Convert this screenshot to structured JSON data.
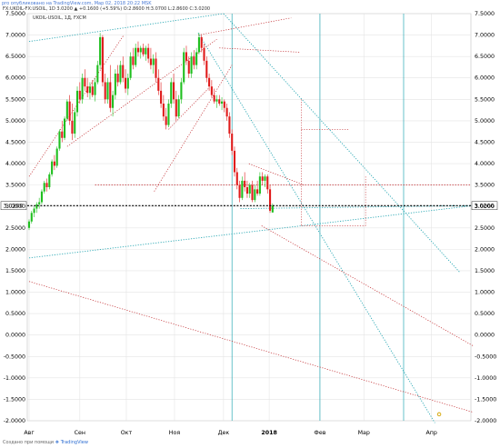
{
  "header": {
    "published_line": "pro опубликовано на TradingView.com, Мар 02, 2018 20:22 MSK",
    "symbol_line": "FX:UKOIL-FX:USOIL, 1D  3.0200  ▲ +0.1600 (+5.59%)  O:2.8600  H:3.0700  L:2.8600  C:3.0200",
    "legend": "UKOIL-USOIL, 1Д, FXCM"
  },
  "footer": {
    "prefix": "Создано при помощи",
    "brand": "TradingView"
  },
  "colors": {
    "up": "#1fbf1f",
    "down": "#e01b1b",
    "grid": "#e4e4e4",
    "cyan": "#2aa8b4",
    "red_dotted": "#c0282c",
    "price_line": "#000000",
    "axis_text": "#000000"
  },
  "chart_data": {
    "type": "candlestick",
    "symbol": "UKOIL-USOIL, 1Д, FXCM",
    "last_price_label": "3.0200",
    "ylim": [
      -2.0,
      7.5
    ],
    "y_ticks": [
      "7.5000",
      "7.0000",
      "6.5000",
      "6.0000",
      "5.5000",
      "5.0000",
      "4.5000",
      "4.0000",
      "3.5000",
      "3.0000",
      "2.5000",
      "2.0000",
      "1.5000",
      "1.0000",
      "0.5000",
      "0.0000",
      "-0.5000",
      "-1.0000",
      "-1.5000",
      "-2.0000"
    ],
    "x_ticks": [
      "Авг",
      "Сен",
      "Окт",
      "Ноя",
      "Дек",
      "2018",
      "Фев",
      "Мар",
      "Апр"
    ],
    "x_tick_days": [
      0,
      60,
      115,
      172,
      230,
      284,
      344,
      396,
      476
    ],
    "candles": [
      {
        "d": 0,
        "o": 2.5,
        "h": 2.7,
        "l": 2.45,
        "c": 2.65
      },
      {
        "d": 3,
        "o": 2.65,
        "h": 2.9,
        "l": 2.6,
        "c": 2.85
      },
      {
        "d": 6,
        "o": 2.85,
        "h": 3.0,
        "l": 2.75,
        "c": 2.95
      },
      {
        "d": 9,
        "o": 2.95,
        "h": 3.1,
        "l": 2.85,
        "c": 3.05
      },
      {
        "d": 12,
        "o": 3.05,
        "h": 3.2,
        "l": 2.95,
        "c": 3.1
      },
      {
        "d": 15,
        "o": 3.1,
        "h": 3.4,
        "l": 3.05,
        "c": 3.35
      },
      {
        "d": 18,
        "o": 3.35,
        "h": 3.6,
        "l": 3.3,
        "c": 3.55
      },
      {
        "d": 21,
        "o": 3.55,
        "h": 3.65,
        "l": 3.35,
        "c": 3.45
      },
      {
        "d": 24,
        "o": 3.45,
        "h": 3.8,
        "l": 3.4,
        "c": 3.75
      },
      {
        "d": 27,
        "o": 3.75,
        "h": 4.1,
        "l": 3.7,
        "c": 4.05
      },
      {
        "d": 30,
        "o": 4.05,
        "h": 4.2,
        "l": 3.85,
        "c": 3.95
      },
      {
        "d": 33,
        "o": 3.95,
        "h": 4.4,
        "l": 3.9,
        "c": 4.35
      },
      {
        "d": 36,
        "o": 4.35,
        "h": 4.8,
        "l": 4.3,
        "c": 4.75
      },
      {
        "d": 39,
        "o": 4.75,
        "h": 5.0,
        "l": 4.5,
        "c": 4.6
      },
      {
        "d": 42,
        "o": 4.6,
        "h": 5.1,
        "l": 4.55,
        "c": 5.05
      },
      {
        "d": 45,
        "o": 5.05,
        "h": 5.5,
        "l": 5.0,
        "c": 5.45
      },
      {
        "d": 48,
        "o": 5.45,
        "h": 5.6,
        "l": 4.9,
        "c": 5.0
      },
      {
        "d": 51,
        "o": 5.0,
        "h": 5.4,
        "l": 4.55,
        "c": 4.7
      },
      {
        "d": 54,
        "o": 4.7,
        "h": 5.3,
        "l": 4.6,
        "c": 5.2
      },
      {
        "d": 57,
        "o": 5.2,
        "h": 5.8,
        "l": 5.1,
        "c": 5.7
      },
      {
        "d": 60,
        "o": 5.7,
        "h": 5.9,
        "l": 5.4,
        "c": 5.5
      },
      {
        "d": 63,
        "o": 5.5,
        "h": 6.1,
        "l": 5.4,
        "c": 6.0
      },
      {
        "d": 66,
        "o": 6.0,
        "h": 6.2,
        "l": 5.7,
        "c": 5.8
      },
      {
        "d": 69,
        "o": 5.8,
        "h": 6.0,
        "l": 5.55,
        "c": 5.65
      },
      {
        "d": 72,
        "o": 5.65,
        "h": 5.9,
        "l": 5.5,
        "c": 5.8
      },
      {
        "d": 75,
        "o": 5.8,
        "h": 5.95,
        "l": 5.55,
        "c": 5.6
      },
      {
        "d": 78,
        "o": 5.6,
        "h": 6.0,
        "l": 5.45,
        "c": 5.9
      },
      {
        "d": 81,
        "o": 5.9,
        "h": 6.4,
        "l": 5.85,
        "c": 6.3
      },
      {
        "d": 84,
        "o": 6.3,
        "h": 7.05,
        "l": 6.2,
        "c": 6.95
      },
      {
        "d": 87,
        "o": 6.95,
        "h": 7.0,
        "l": 5.8,
        "c": 5.9
      },
      {
        "d": 90,
        "o": 5.9,
        "h": 6.1,
        "l": 5.4,
        "c": 5.5
      },
      {
        "d": 93,
        "o": 5.5,
        "h": 6.0,
        "l": 5.4,
        "c": 5.9
      },
      {
        "d": 96,
        "o": 5.9,
        "h": 6.3,
        "l": 5.2,
        "c": 5.3
      },
      {
        "d": 99,
        "o": 5.3,
        "h": 5.7,
        "l": 5.1,
        "c": 5.6
      },
      {
        "d": 102,
        "o": 5.6,
        "h": 6.2,
        "l": 5.5,
        "c": 6.1
      },
      {
        "d": 105,
        "o": 6.1,
        "h": 6.3,
        "l": 5.8,
        "c": 5.9
      },
      {
        "d": 108,
        "o": 5.9,
        "h": 6.4,
        "l": 5.85,
        "c": 6.3
      },
      {
        "d": 111,
        "o": 6.3,
        "h": 6.5,
        "l": 5.9,
        "c": 6.0
      },
      {
        "d": 114,
        "o": 6.0,
        "h": 6.2,
        "l": 5.65,
        "c": 5.75
      },
      {
        "d": 117,
        "o": 5.75,
        "h": 6.1,
        "l": 5.6,
        "c": 6.0
      },
      {
        "d": 120,
        "o": 6.0,
        "h": 6.6,
        "l": 5.95,
        "c": 6.5
      },
      {
        "d": 123,
        "o": 6.5,
        "h": 6.7,
        "l": 6.2,
        "c": 6.3
      },
      {
        "d": 126,
        "o": 6.3,
        "h": 6.8,
        "l": 6.25,
        "c": 6.7
      },
      {
        "d": 129,
        "o": 6.7,
        "h": 6.85,
        "l": 6.5,
        "c": 6.6
      },
      {
        "d": 132,
        "o": 6.6,
        "h": 6.75,
        "l": 6.45,
        "c": 6.7
      },
      {
        "d": 135,
        "o": 6.7,
        "h": 6.8,
        "l": 6.5,
        "c": 6.55
      },
      {
        "d": 138,
        "o": 6.55,
        "h": 6.75,
        "l": 6.4,
        "c": 6.7
      },
      {
        "d": 141,
        "o": 6.7,
        "h": 6.8,
        "l": 6.35,
        "c": 6.45
      },
      {
        "d": 144,
        "o": 6.45,
        "h": 6.7,
        "l": 6.2,
        "c": 6.3
      },
      {
        "d": 147,
        "o": 6.3,
        "h": 6.55,
        "l": 6.1,
        "c": 6.45
      },
      {
        "d": 150,
        "o": 6.45,
        "h": 6.6,
        "l": 5.9,
        "c": 6.0
      },
      {
        "d": 153,
        "o": 6.0,
        "h": 6.2,
        "l": 5.6,
        "c": 5.7
      },
      {
        "d": 156,
        "o": 5.7,
        "h": 5.9,
        "l": 5.3,
        "c": 5.4
      },
      {
        "d": 159,
        "o": 5.4,
        "h": 5.6,
        "l": 5.0,
        "c": 5.1
      },
      {
        "d": 162,
        "o": 5.1,
        "h": 5.3,
        "l": 4.8,
        "c": 4.9
      },
      {
        "d": 165,
        "o": 4.9,
        "h": 5.5,
        "l": 4.85,
        "c": 5.4
      },
      {
        "d": 168,
        "o": 5.4,
        "h": 6.0,
        "l": 5.3,
        "c": 5.9
      },
      {
        "d": 171,
        "o": 5.9,
        "h": 6.1,
        "l": 5.4,
        "c": 5.5
      },
      {
        "d": 174,
        "o": 5.5,
        "h": 5.7,
        "l": 5.0,
        "c": 5.1
      },
      {
        "d": 177,
        "o": 5.1,
        "h": 5.6,
        "l": 5.05,
        "c": 5.5
      },
      {
        "d": 180,
        "o": 5.5,
        "h": 6.0,
        "l": 5.4,
        "c": 5.9
      },
      {
        "d": 183,
        "o": 5.9,
        "h": 6.7,
        "l": 5.85,
        "c": 6.6
      },
      {
        "d": 186,
        "o": 6.6,
        "h": 6.75,
        "l": 6.3,
        "c": 6.4
      },
      {
        "d": 189,
        "o": 6.4,
        "h": 6.5,
        "l": 6.0,
        "c": 6.1
      },
      {
        "d": 192,
        "o": 6.1,
        "h": 6.6,
        "l": 6.0,
        "c": 6.5
      },
      {
        "d": 195,
        "o": 6.5,
        "h": 6.65,
        "l": 6.2,
        "c": 6.3
      },
      {
        "d": 198,
        "o": 6.3,
        "h": 6.7,
        "l": 6.2,
        "c": 6.6
      },
      {
        "d": 201,
        "o": 6.6,
        "h": 7.05,
        "l": 6.55,
        "c": 6.95
      },
      {
        "d": 204,
        "o": 6.95,
        "h": 7.0,
        "l": 6.6,
        "c": 6.7
      },
      {
        "d": 207,
        "o": 6.7,
        "h": 6.8,
        "l": 6.3,
        "c": 6.4
      },
      {
        "d": 210,
        "o": 6.4,
        "h": 6.5,
        "l": 5.9,
        "c": 6.0
      },
      {
        "d": 213,
        "o": 6.0,
        "h": 6.1,
        "l": 5.7,
        "c": 5.8
      },
      {
        "d": 216,
        "o": 5.8,
        "h": 5.95,
        "l": 5.55,
        "c": 5.6
      },
      {
        "d": 219,
        "o": 5.6,
        "h": 5.75,
        "l": 5.4,
        "c": 5.45
      },
      {
        "d": 222,
        "o": 5.45,
        "h": 5.6,
        "l": 5.3,
        "c": 5.5
      },
      {
        "d": 225,
        "o": 5.5,
        "h": 5.6,
        "l": 5.35,
        "c": 5.4
      },
      {
        "d": 228,
        "o": 5.4,
        "h": 5.55,
        "l": 5.25,
        "c": 5.45
      },
      {
        "d": 231,
        "o": 5.45,
        "h": 5.5,
        "l": 5.2,
        "c": 5.3
      },
      {
        "d": 234,
        "o": 5.3,
        "h": 5.4,
        "l": 5.0,
        "c": 5.1
      },
      {
        "d": 237,
        "o": 5.1,
        "h": 5.2,
        "l": 4.6,
        "c": 4.7
      },
      {
        "d": 240,
        "o": 4.7,
        "h": 4.8,
        "l": 4.2,
        "c": 4.3
      },
      {
        "d": 243,
        "o": 4.3,
        "h": 4.4,
        "l": 3.7,
        "c": 3.8
      },
      {
        "d": 246,
        "o": 3.8,
        "h": 3.9,
        "l": 3.4,
        "c": 3.5
      },
      {
        "d": 249,
        "o": 3.5,
        "h": 3.6,
        "l": 3.1,
        "c": 3.2
      },
      {
        "d": 252,
        "o": 3.2,
        "h": 3.7,
        "l": 3.15,
        "c": 3.6
      },
      {
        "d": 255,
        "o": 3.6,
        "h": 3.8,
        "l": 3.35,
        "c": 3.45
      },
      {
        "d": 258,
        "o": 3.45,
        "h": 3.6,
        "l": 3.2,
        "c": 3.3
      },
      {
        "d": 261,
        "o": 3.3,
        "h": 3.55,
        "l": 3.2,
        "c": 3.5
      },
      {
        "d": 264,
        "o": 3.5,
        "h": 3.6,
        "l": 3.1,
        "c": 3.15
      },
      {
        "d": 267,
        "o": 3.15,
        "h": 3.5,
        "l": 3.1,
        "c": 3.4
      },
      {
        "d": 270,
        "o": 3.4,
        "h": 3.6,
        "l": 3.25,
        "c": 3.3
      },
      {
        "d": 273,
        "o": 3.3,
        "h": 3.8,
        "l": 3.25,
        "c": 3.7
      },
      {
        "d": 276,
        "o": 3.7,
        "h": 3.8,
        "l": 3.5,
        "c": 3.6
      },
      {
        "d": 279,
        "o": 3.6,
        "h": 3.75,
        "l": 3.45,
        "c": 3.7
      },
      {
        "d": 282,
        "o": 3.7,
        "h": 3.75,
        "l": 3.3,
        "c": 3.4
      },
      {
        "d": 285,
        "o": 3.4,
        "h": 3.5,
        "l": 2.85,
        "c": 2.9
      },
      {
        "d": 288,
        "o": 2.86,
        "h": 3.07,
        "l": 2.86,
        "c": 3.02
      }
    ]
  }
}
